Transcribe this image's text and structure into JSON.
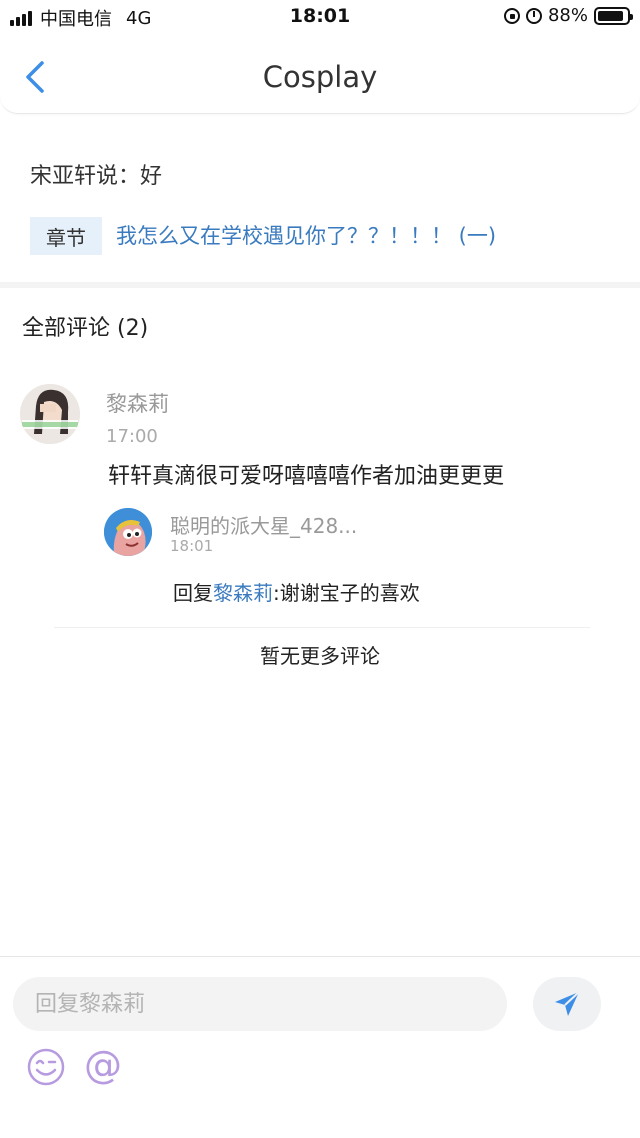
{
  "status_bar": {
    "carrier": "中国电信",
    "network": "4G",
    "time": "18:01",
    "battery_text": "88%",
    "battery_level": 0.88
  },
  "nav": {
    "title": "Cosplay",
    "back_icon": "chevron-left-icon"
  },
  "header": {
    "quote": "宋亚轩说：好",
    "chapter_tag": "章节",
    "chapter_title": "我怎么又在学校遇见你了？？！！！ (一)"
  },
  "comments": {
    "heading": "全部评论 (2)",
    "items": [
      {
        "author": "黎森莉",
        "time": "17:00",
        "text": "轩轩真滴很可爱呀嘻嘻嘻作者加油更更更",
        "reply": {
          "author": "聪明的派大星_428...",
          "time": "18:01",
          "prefix": "回复",
          "mention": "黎森莉",
          "text": ":谢谢宝子的喜欢"
        }
      }
    ],
    "footer": "暂无更多评论"
  },
  "input_bar": {
    "placeholder": "回复黎森莉",
    "at_symbol": "@",
    "send_icon": "send-icon",
    "emoji_icon": "emoji-icon"
  },
  "colors": {
    "accent": "#3a7bbf",
    "send_icon": "#3d8ee6",
    "emoji_icon": "#b79be0"
  }
}
